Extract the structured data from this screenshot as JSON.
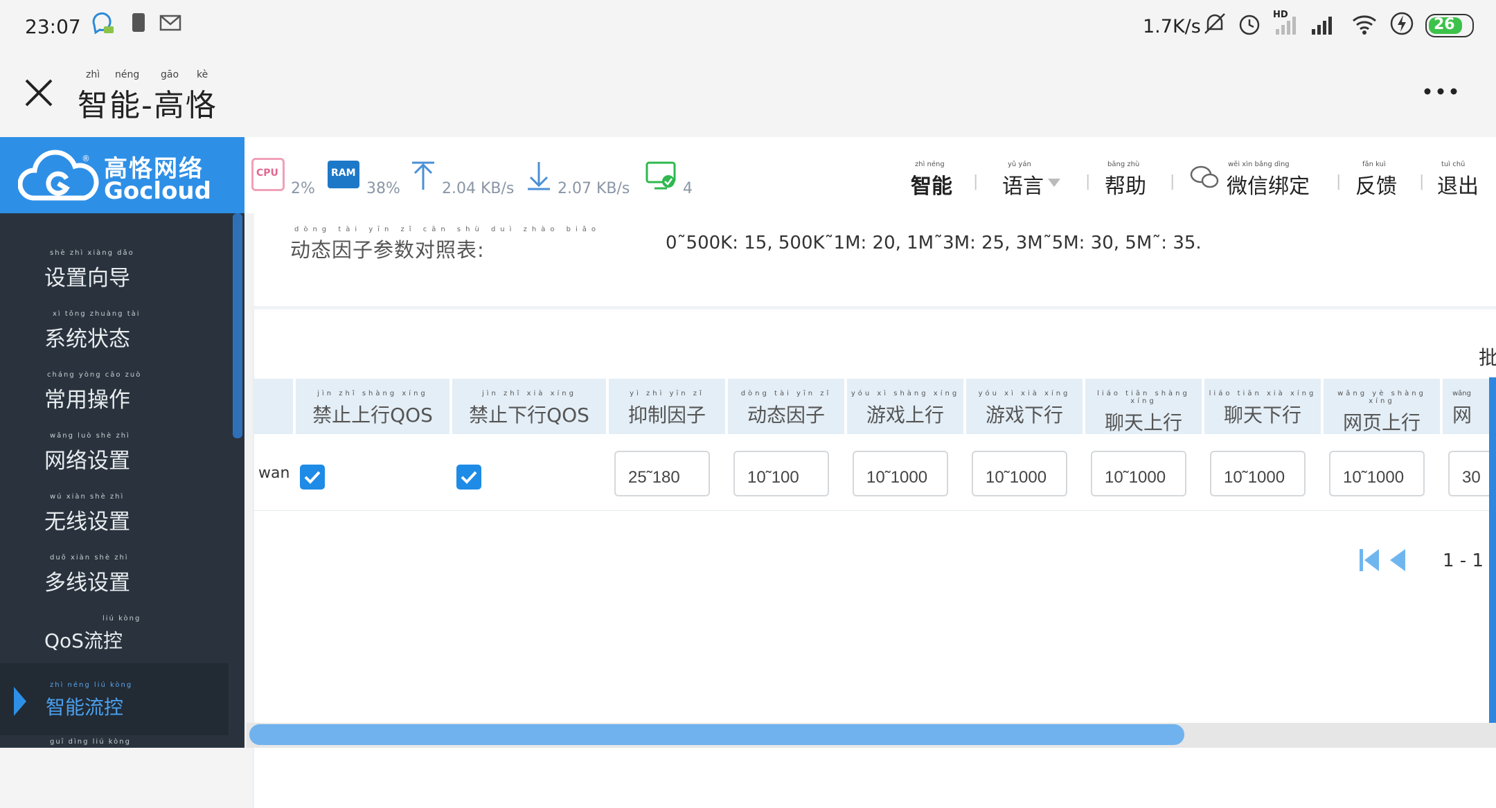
{
  "status_bar": {
    "time": "23:07",
    "net_speed": "1.7K/s",
    "battery": "26",
    "hd_label": "HD",
    "icons": [
      "chat-bubble-icon",
      "sim-icon",
      "mail-icon",
      "mute-icon",
      "alarm-icon",
      "signal-icon",
      "signal-icon",
      "wifi-icon",
      "lightning-icon",
      "battery-icon"
    ]
  },
  "title_bar": {
    "title": "智能-高恪",
    "pinyin": [
      "zhì",
      "néng",
      "gāo",
      "kè"
    ],
    "close_icon": "close-icon",
    "more_icon": "more-icon"
  },
  "logo": {
    "cn": "高恪网络",
    "en": "Gocloud",
    "reg": "®"
  },
  "header": {
    "cpu_label": "CPU",
    "cpu_value": "2%",
    "ram_label": "RAM",
    "ram_value": "38%",
    "upload": "2.04 KB/s",
    "download": "2.07 KB/s",
    "devices": "4",
    "nav": [
      {
        "label": "智能",
        "pinyin": "zhì néng"
      },
      {
        "label": "语言",
        "pinyin": "yǔ yán"
      },
      {
        "label": "帮助",
        "pinyin": "bāng zhù"
      },
      {
        "label": "微信绑定",
        "pinyin": "wēi xìn bǎng dìng"
      },
      {
        "label": "反馈",
        "pinyin": "fǎn kuì"
      },
      {
        "label": "退出",
        "pinyin": "tuì chū"
      }
    ]
  },
  "sidebar": {
    "items": [
      {
        "label": "设置向导",
        "pinyin": "shè zhì xiàng dǎo"
      },
      {
        "label": "系统状态",
        "pinyin": "xì tǒng zhuàng tài"
      },
      {
        "label": "常用操作",
        "pinyin": "cháng yòng cāo zuò"
      },
      {
        "label": "网络设置",
        "pinyin": "wǎng luò shè zhì"
      },
      {
        "label": "无线设置",
        "pinyin": "wú xiàn shè zhì"
      },
      {
        "label": "多线设置",
        "pinyin": "duō xiàn shè zhì"
      },
      {
        "label": "QoS流控",
        "pinyin": "liú kòng"
      },
      {
        "label": "智能流控",
        "pinyin": "zhì néng liú kòng"
      },
      {
        "label": "",
        "pinyin": "guī dìng liú kòng"
      }
    ]
  },
  "main": {
    "dyn_label": "动态因子参数对照表:",
    "dyn_pinyin": "dòng tài yīn zǐ cān shù duì zhào biǎo",
    "dyn_value": "0˜500K: 15, 500K˜1M: 20, 1M˜3M: 25, 3M˜5M: 30, 5M˜: 35.",
    "partial_label": "批",
    "table": {
      "headers": [
        {
          "label": "禁止上行QOS",
          "pinyin": "jìn zhǐ shàng xíng"
        },
        {
          "label": "禁止下行QOS",
          "pinyin": "jìn zhǐ xià xíng"
        },
        {
          "label": "抑制因子",
          "pinyin": "yì zhì yīn zǐ"
        },
        {
          "label": "动态因子",
          "pinyin": "dòng tài yīn zǐ"
        },
        {
          "label": "游戏上行",
          "pinyin": "yóu xì shàng xíng"
        },
        {
          "label": "游戏下行",
          "pinyin": "yóu xì xià xíng"
        },
        {
          "label": "聊天上行",
          "pinyin": "liáo tiān shàng xíng"
        },
        {
          "label": "聊天下行",
          "pinyin": "liáo tiān xià xíng"
        },
        {
          "label": "网页上行",
          "pinyin": "wǎng yè shàng xíng"
        },
        {
          "label": "网",
          "pinyin": "wǎng"
        }
      ],
      "row": {
        "name": "wan",
        "up_checked": true,
        "down_checked": true,
        "values": [
          "25˜180",
          "10˜100",
          "10˜1000",
          "10˜1000",
          "10˜1000",
          "10˜1000",
          "10˜1000",
          "30"
        ]
      }
    },
    "pager": "1 - 1"
  }
}
